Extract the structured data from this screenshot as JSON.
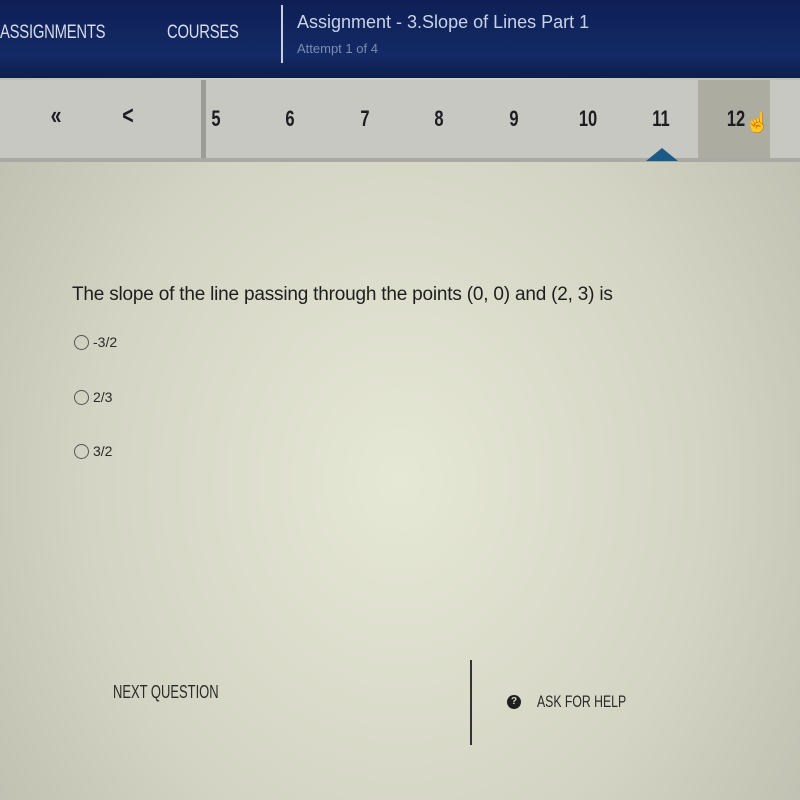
{
  "topbar": {
    "nav": [
      "ASSIGNMENTS",
      "COURSES"
    ],
    "title": "Assignment - 3.Slope of Lines Part 1",
    "subtitle": "Attempt 1 of 4"
  },
  "pager": {
    "first_icon": "«",
    "prev_icon": "<",
    "pages": [
      "5",
      "6",
      "7",
      "8",
      "9",
      "10",
      "11",
      "12"
    ],
    "current_page": "11",
    "hovered_page": "12",
    "cursor_icon": "☝"
  },
  "question": {
    "text": "The slope of the line passing through the points (0, 0) and (2, 3) is",
    "options": [
      "-3/2",
      "2/3",
      "3/2"
    ]
  },
  "footer": {
    "next_label": "NEXT QUESTION",
    "help_label": "ASK FOR HELP",
    "help_icon": "?"
  },
  "colors": {
    "header": "#132a66",
    "caret": "#1b5a86"
  }
}
